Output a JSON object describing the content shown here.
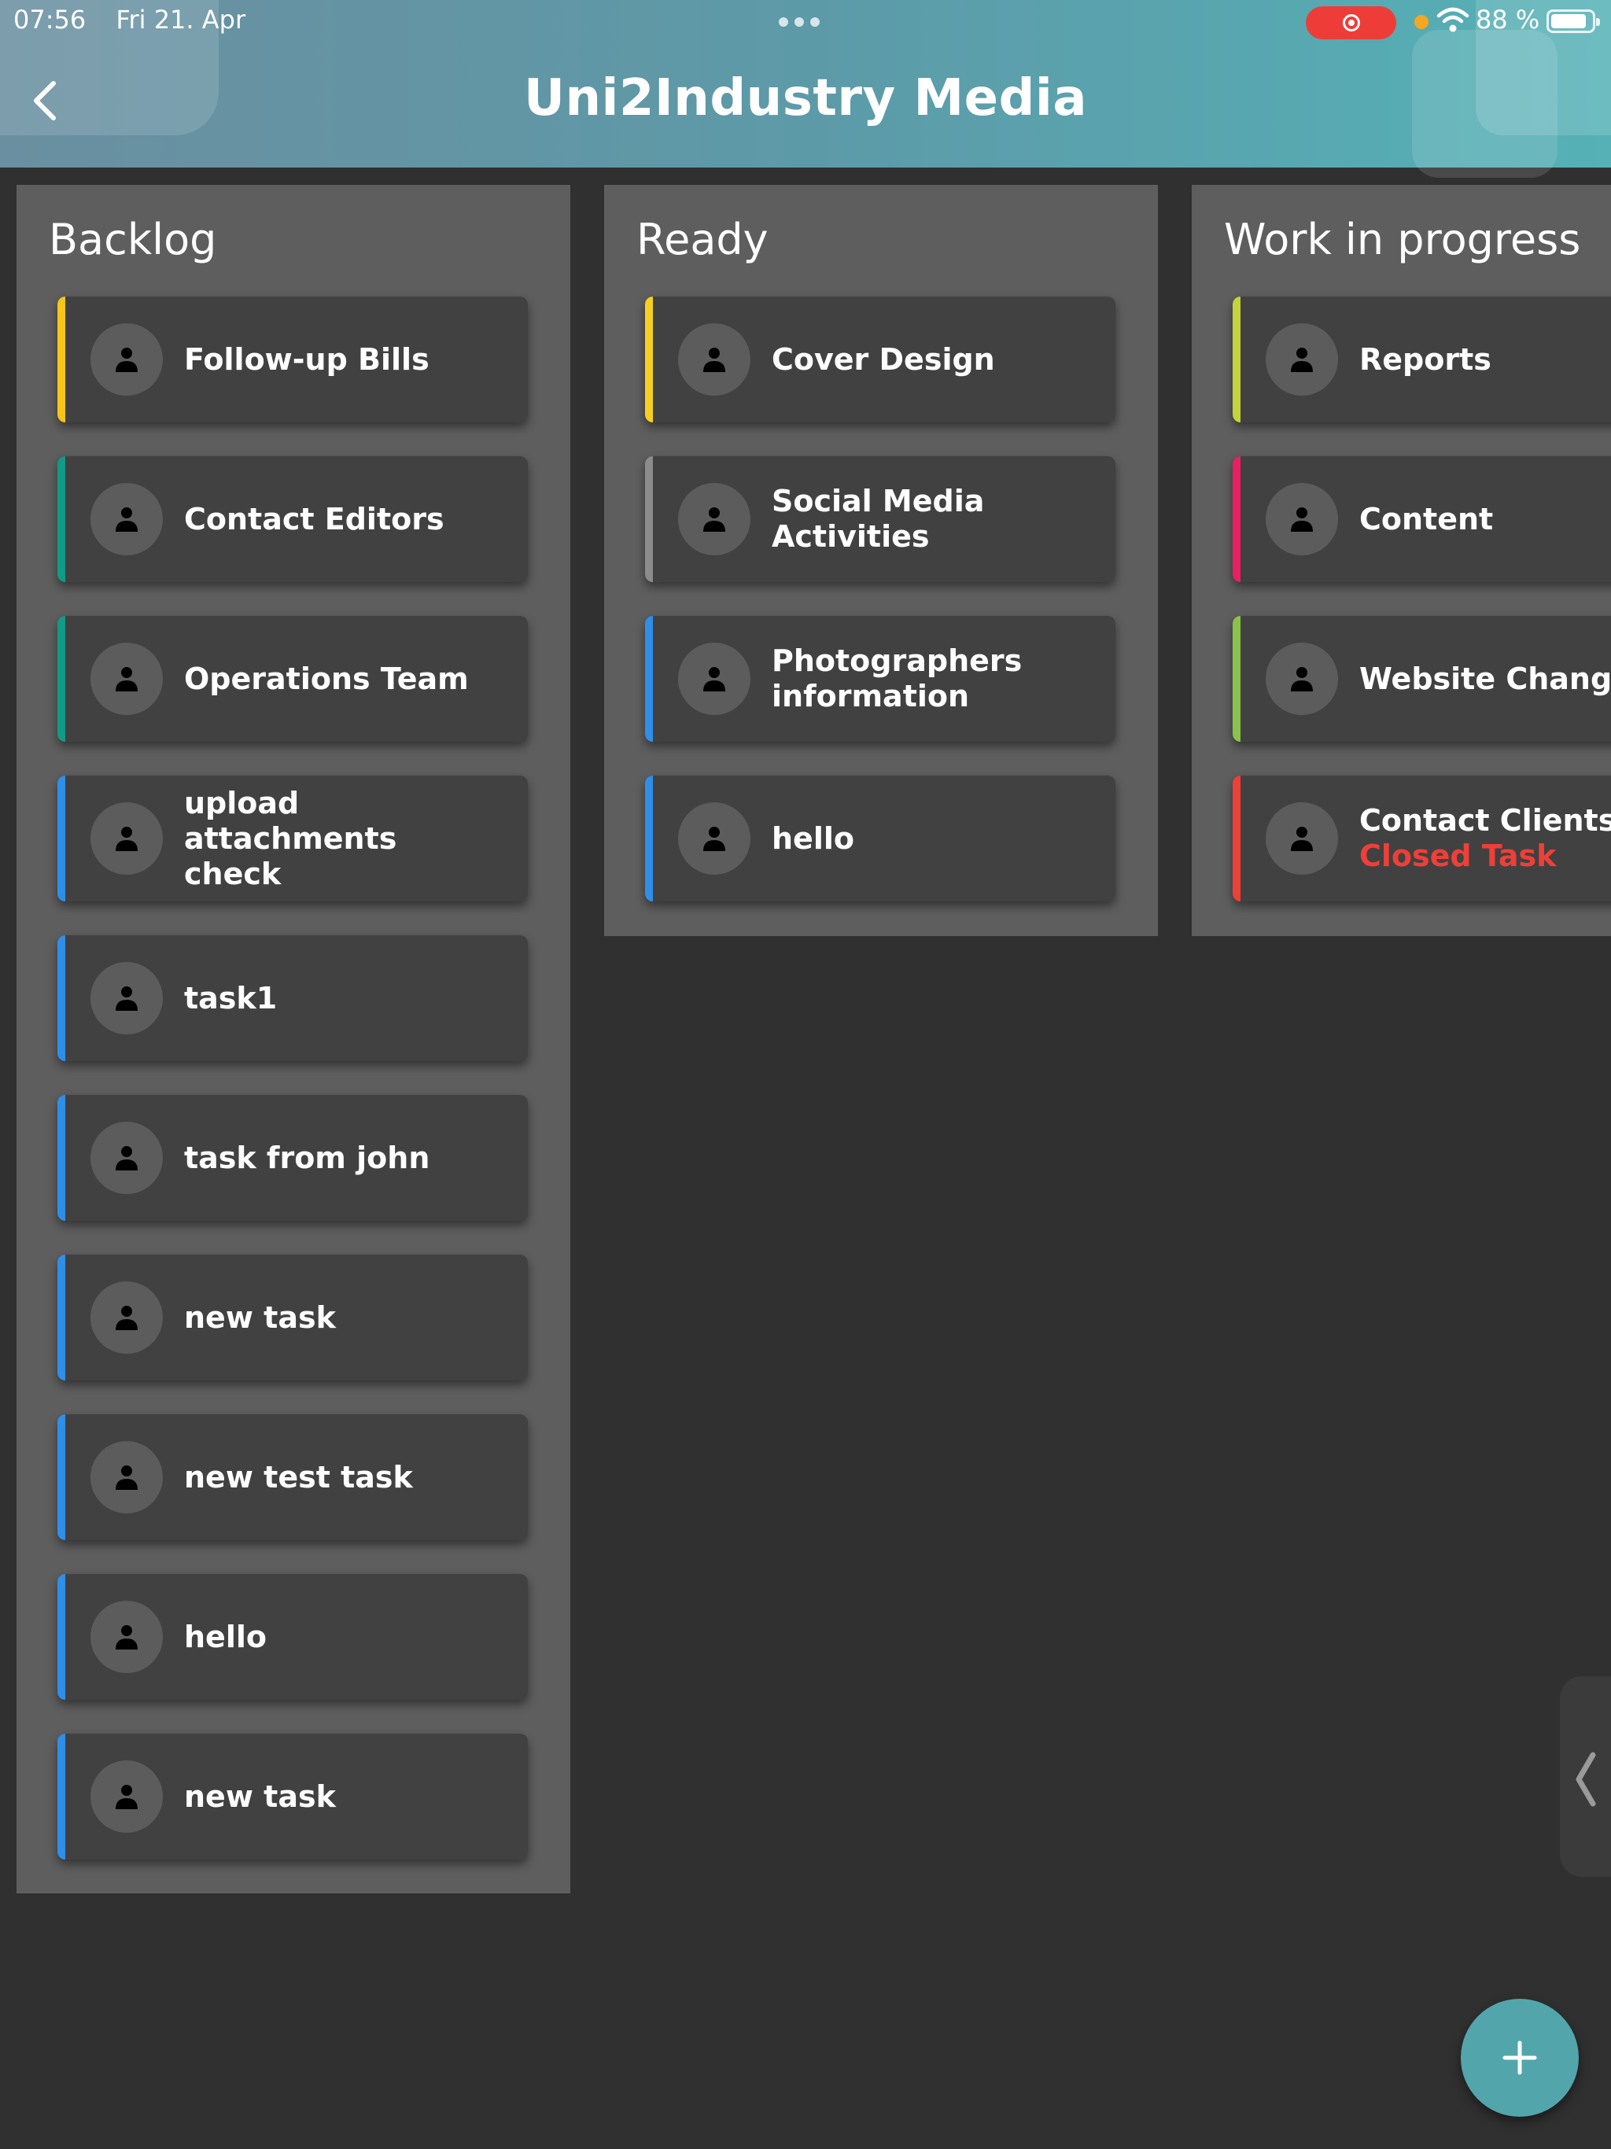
{
  "status_bar": {
    "time": "07:56",
    "date": "Fri 21. Apr",
    "battery": "88 %"
  },
  "header": {
    "title": "Uni2Industry Media",
    "back_icon": "chevron-left-icon"
  },
  "columns": [
    {
      "title": "Backlog",
      "cards": [
        {
          "label": "Follow-up Bills",
          "color": "#f5c518"
        },
        {
          "label": "Contact Editors",
          "color": "#119a84"
        },
        {
          "label": "Operations Team",
          "color": "#119a84"
        },
        {
          "label": "upload attachments check",
          "color": "#2f8fe8"
        },
        {
          "label": "task1",
          "color": "#2f8fe8"
        },
        {
          "label": "task from john",
          "color": "#2f8fe8"
        },
        {
          "label": "new task",
          "color": "#2f8fe8"
        },
        {
          "label": "new test task",
          "color": "#2f8fe8"
        },
        {
          "label": "hello",
          "color": "#2f8fe8"
        },
        {
          "label": "new task",
          "color": "#2f8fe8"
        }
      ]
    },
    {
      "title": "Ready",
      "cards": [
        {
          "label": "Cover Design",
          "color": "#f5d024"
        },
        {
          "label": "Social Media Activities",
          "color": "#8c8c8c"
        },
        {
          "label": "Photographers information",
          "color": "#2f8fe8"
        },
        {
          "label": "hello",
          "color": "#2f8fe8"
        }
      ]
    },
    {
      "title": "Work in progress",
      "cards": [
        {
          "label": "Reports",
          "color": "#c6d23a"
        },
        {
          "label": "Content",
          "color": "#e91e63"
        },
        {
          "label": "Website Changes",
          "color": "#8bc34a"
        },
        {
          "label": "Contact Clients",
          "status": "Closed Task",
          "color": "#ee3f38"
        }
      ]
    }
  ],
  "fab": {
    "icon": "plus-icon"
  },
  "side_handle": {
    "icon": "chevron-left-icon"
  }
}
